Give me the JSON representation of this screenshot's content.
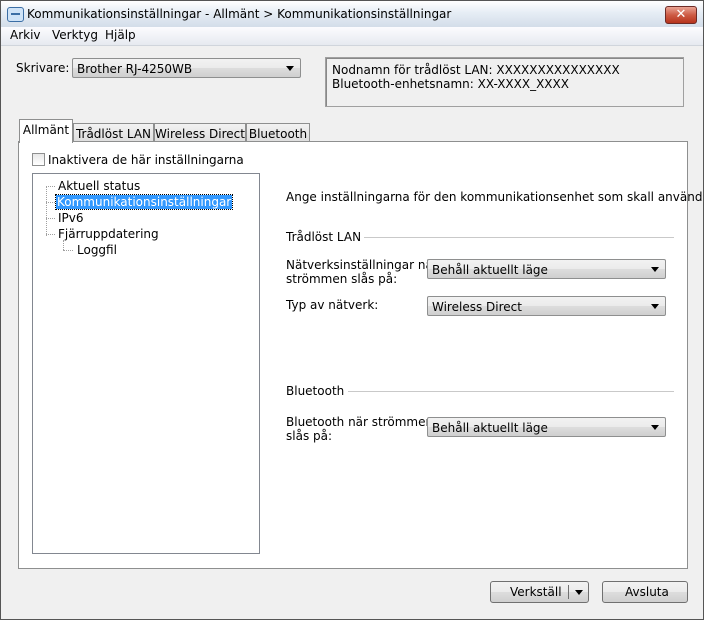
{
  "window": {
    "title": "Kommunikationsinställningar - Allmänt > Kommunikationsinställningar",
    "close_glyph": "✕"
  },
  "menu": [
    {
      "label": "Arkiv"
    },
    {
      "label": "Verktyg"
    },
    {
      "label": "Hjälp"
    }
  ],
  "printer": {
    "label": "Skrivare:",
    "value": "Brother RJ-4250WB"
  },
  "info": {
    "wlan_node_name": "Nodnamn för trådlöst LAN: XXXXXXXXXXXXXXX",
    "bt_device_name": "Bluetooth-enhetsnamn: XX-XXXX_XXXX"
  },
  "tabs": [
    {
      "label": "Allmänt",
      "active": true
    },
    {
      "label": "Trådlöst LAN",
      "active": false
    },
    {
      "label": "Wireless Direct",
      "active": false
    },
    {
      "label": "Bluetooth",
      "active": false
    }
  ],
  "disable_settings": {
    "label": "Inaktivera de här inställningarna",
    "checked": false
  },
  "tree": {
    "items": [
      {
        "label": "Aktuell status",
        "selected": false
      },
      {
        "label": "Kommunikationsinställningar",
        "selected": true
      },
      {
        "label": "IPv6",
        "selected": false
      },
      {
        "label": "Fjärruppdatering",
        "selected": false
      },
      {
        "label": "Loggfil",
        "selected": false
      }
    ]
  },
  "settings": {
    "description": "Ange inställningarna för den kommunikationsenhet som skall användas.",
    "wlan": {
      "title": "Trådlöst LAN",
      "power_on_label_1": "Nätverksinställningar när",
      "power_on_label_2": "strömmen slås på:",
      "power_on_value": "Behåll aktuellt läge",
      "network_type_label": "Typ av nätverk:",
      "network_type_value": "Wireless Direct"
    },
    "bluetooth": {
      "title": "Bluetooth",
      "power_on_label_1": "Bluetooth när strömmen",
      "power_on_label_2": "slås på:",
      "power_on_value": "Behåll aktuellt läge"
    }
  },
  "footer": {
    "apply_label": "Verkställ",
    "exit_label": "Avsluta"
  }
}
